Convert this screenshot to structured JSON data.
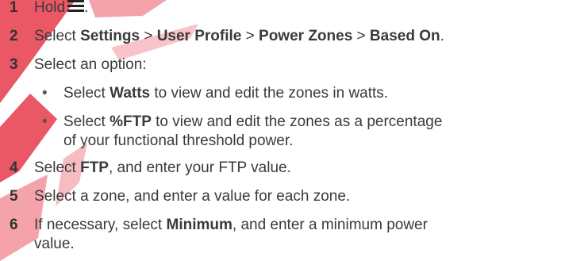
{
  "steps": [
    {
      "num": "1",
      "pre": "Hold",
      "icon": "menu-icon",
      "post": "."
    },
    {
      "num": "2",
      "t1": "Select ",
      "b1": "Settings",
      "t2": " > ",
      "b2": "User Profile",
      "t3": " > ",
      "b3": "Power Zones",
      "t4": " > ",
      "b4": "Based On",
      "t5": "."
    },
    {
      "num": "3",
      "t1": "Select an option:"
    },
    {
      "num": "4",
      "t1": "Select ",
      "b1": "FTP",
      "t2": ", and enter your FTP value."
    },
    {
      "num": "5",
      "t1": "Select a zone, and enter a value for each zone."
    },
    {
      "num": "6",
      "t1": "If necessary, select ",
      "b1": "Minimum",
      "t2": ", and enter a minimum power",
      "t3": "value."
    }
  ],
  "options": [
    {
      "bullet": "•",
      "t1": "Select ",
      "b1": "Watts",
      "t2": " to view and edit the zones in watts."
    },
    {
      "bullet": "•",
      "t1": "Select ",
      "b1": "%FTP",
      "t2": " to view and edit the zones as a percentage",
      "t3": "of your functional threshold power."
    }
  ],
  "colors": {
    "text": "#3a3a3a",
    "watermark": "#e23a4a"
  }
}
